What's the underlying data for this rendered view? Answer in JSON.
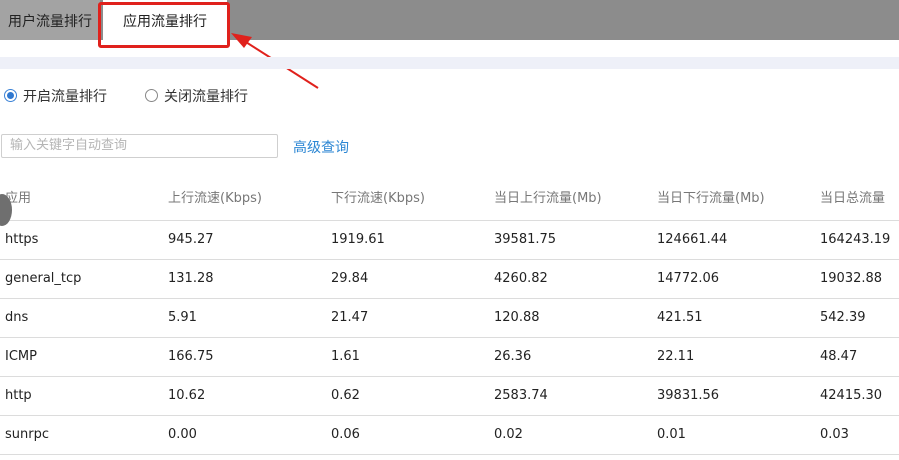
{
  "tabs": {
    "user_traffic": "用户流量排行",
    "app_traffic": "应用流量排行"
  },
  "radios": {
    "enable": "开启流量排行",
    "disable": "关闭流量排行",
    "selected": "enable"
  },
  "search": {
    "placeholder": "输入关键字自动查询",
    "advanced_label": "高级查询"
  },
  "table": {
    "headers": [
      "应用",
      "上行流速(Kbps)",
      "下行流速(Kbps)",
      "当日上行流量(Mb)",
      "当日下行流量(Mb)",
      "当日总流量"
    ],
    "rows": [
      [
        "https",
        "945.27",
        "1919.61",
        "39581.75",
        "124661.44",
        "164243.19"
      ],
      [
        "general_tcp",
        "131.28",
        "29.84",
        "4260.82",
        "14772.06",
        "19032.88"
      ],
      [
        "dns",
        "5.91",
        "21.47",
        "120.88",
        "421.51",
        "542.39"
      ],
      [
        "ICMP",
        "166.75",
        "1.61",
        "26.36",
        "22.11",
        "48.47"
      ],
      [
        "http",
        "10.62",
        "0.62",
        "2583.74",
        "39831.56",
        "42415.30"
      ],
      [
        "sunrpc",
        "0.00",
        "0.06",
        "0.02",
        "0.01",
        "0.03"
      ]
    ]
  },
  "colors": {
    "highlight": "#e0211c",
    "link": "#2b86d3",
    "radio_selected": "#2f78d0"
  }
}
